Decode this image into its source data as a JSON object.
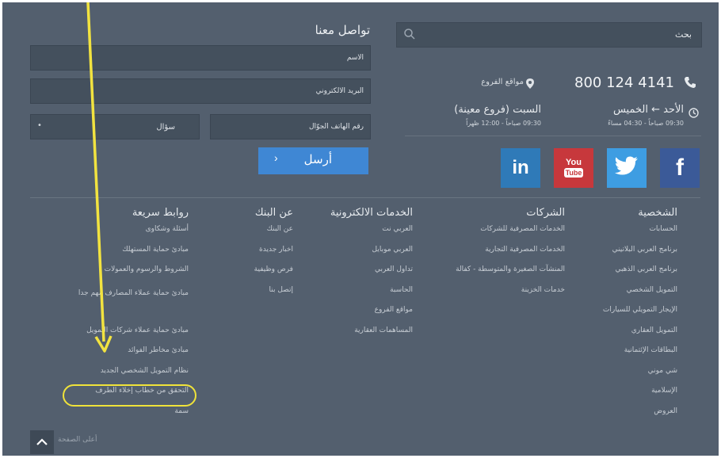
{
  "search": {
    "placeholder": "بحث"
  },
  "contact": {
    "title": "تواصل معنا",
    "name_placeholder": "الاسم",
    "email_placeholder": "البريد الالكتروني",
    "phone_placeholder": "رقم الهاتف الجوّال",
    "subject_value": "سؤال",
    "send_label": "أرسل",
    "send_chevron": "›"
  },
  "info": {
    "phone": "800 124 4141",
    "branches": "مواقع الفروع",
    "weekday_days": "الأحد ← الخميس",
    "weekday_time": "09:30 صباحاً - 04:30 مساءً",
    "saturday_days": "السبت (فروع معينة)",
    "saturday_time": "09:30 صباحاً - 12:00 ظهراً"
  },
  "social": {
    "facebook": "f",
    "youtube_top": "You",
    "youtube_bottom": "Tube",
    "linkedin": "in"
  },
  "footer": {
    "personal": {
      "title": "الشخصية",
      "items": [
        "الحسابات",
        "برنامج العربي البلاتيني",
        "برنامج العربي الذهبي",
        "التمويل الشخصي",
        "الإيجار التمويلي للسيارات",
        "التمويل العقاري",
        "البطاقات الإئتمانية",
        "شي موني",
        "الإسلامية",
        "العروض"
      ]
    },
    "companies": {
      "title": "الشركات",
      "items": [
        "الخدمات المصرفية للشركات",
        "الخدمات المصرفية التجارية",
        "المنشآت الصغيرة والمتوسطة - كفالة",
        "خدمات الخزينة"
      ]
    },
    "eservices": {
      "title": "الخدمات الالكترونية",
      "items": [
        "العربي نت",
        "العربي موبايل",
        "تداول العربي",
        "الحاسبة",
        "مواقع الفروع",
        "المساهمات العقارية"
      ]
    },
    "about": {
      "title": "عن البنك",
      "items": [
        "عن البنك",
        "اخبار جديدة",
        "فرص وظيفية",
        "إتصل بنا"
      ]
    },
    "quick": {
      "title": "روابط سريعة",
      "items": [
        "أسئلة وشكاوى",
        "مبادئ حماية المستهلك",
        "الشروط والرسوم والعمولات",
        "مبادئ حماية عملاء المصارف مهم جدا",
        "مبادئ حماية عملاء شركات التمويل",
        "مبادئ مخاطر الفوائد",
        "نظام التمويل الشخصي الجديد",
        "التحقق من خطاب إخلاء الطرف",
        "سمة"
      ]
    }
  },
  "scroll_top": {
    "label": "أعلى الصفحة"
  },
  "colors": {
    "background": "#535f6e",
    "accent": "#3f87d4",
    "highlight": "#f0e33a"
  }
}
